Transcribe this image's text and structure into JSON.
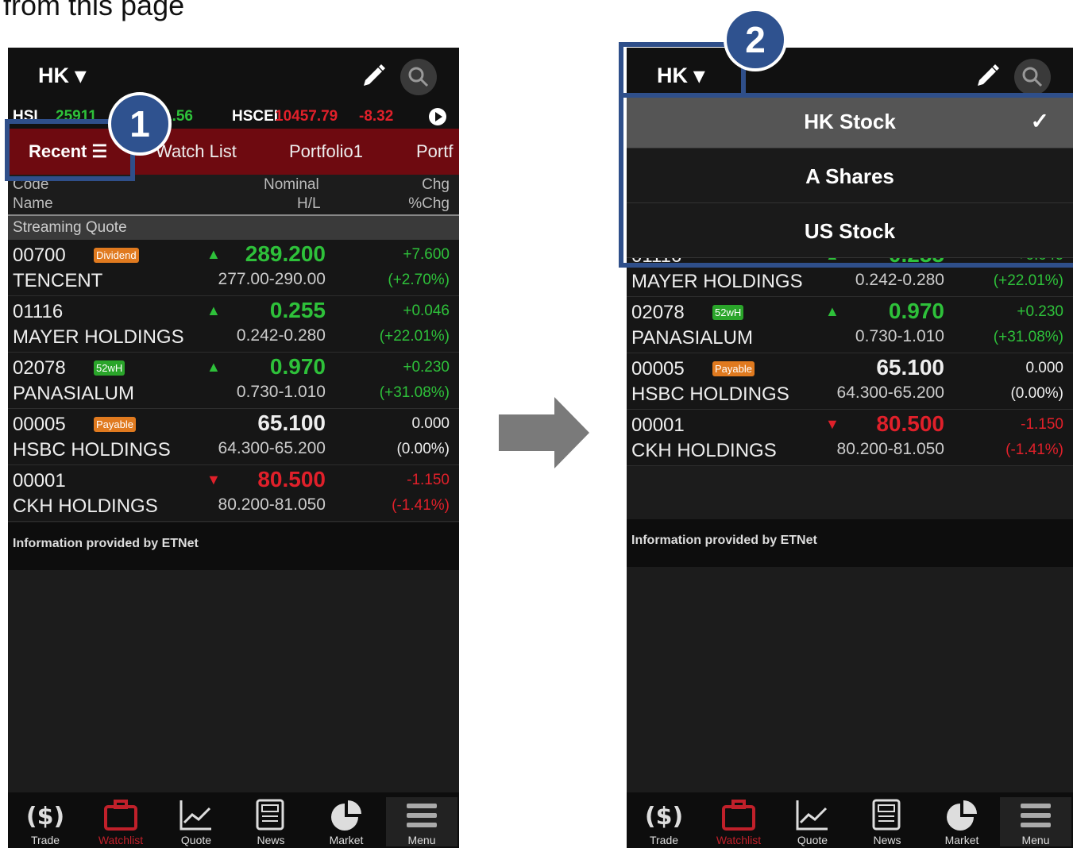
{
  "caption": "from this page",
  "topbar": {
    "market": "HK ▾"
  },
  "ticker": [
    {
      "text": "HSI",
      "color": "#ffffff"
    },
    {
      "text": "25911",
      "color": "#2ec13a"
    },
    {
      "text": "1.56",
      "color": "#2ec13a"
    },
    {
      "text": "HSCEI",
      "color": "#ffffff"
    },
    {
      "text": "10457.79",
      "color": "#e0202a"
    },
    {
      "text": "-8.32",
      "color": "#e0202a"
    }
  ],
  "tabs": [
    "Recent ☰",
    "Watch List",
    "Portfolio1",
    "Portf"
  ],
  "columns": {
    "code": "Code",
    "name": "Name",
    "nominal": "Nominal",
    "hl": "H/L",
    "chg": "Chg",
    "pct": "%Chg"
  },
  "section_title": "Streaming Quote",
  "stocks": [
    {
      "code": "00700",
      "name": "TENCENT",
      "badge": "Dividend",
      "badge_color": "orange",
      "arrow": "▲",
      "direction": "up",
      "price": "289.200",
      "hl": "277.00-290.00",
      "chg": "+7.600",
      "pct": "(+2.70%)"
    },
    {
      "code": "01116",
      "name": "MAYER HOLDINGS",
      "badge": "",
      "badge_color": "",
      "arrow": "▲",
      "direction": "up",
      "price": "0.255",
      "hl": "0.242-0.280",
      "chg": "+0.046",
      "pct": "(+22.01%)"
    },
    {
      "code": "02078",
      "name": "PANASIALUM",
      "badge": "52wH",
      "badge_color": "green",
      "arrow": "▲",
      "direction": "up",
      "price": "0.970",
      "hl": "0.730-1.010",
      "chg": "+0.230",
      "pct": "(+31.08%)"
    },
    {
      "code": "00005",
      "name": "HSBC HOLDINGS",
      "badge": "Payable",
      "badge_color": "orange",
      "arrow": "",
      "direction": "flat",
      "price": "65.100",
      "hl": "64.300-65.200",
      "chg": "0.000",
      "pct": "(0.00%)"
    },
    {
      "code": "00001",
      "name": "CKH HOLDINGS",
      "badge": "",
      "badge_color": "",
      "arrow": "▼",
      "direction": "down",
      "price": "80.500",
      "hl": "80.200-81.050",
      "chg": "-1.150",
      "pct": "(-1.41%)"
    }
  ],
  "info_text": "Information provided by ETNet",
  "nav": [
    {
      "label": "Trade",
      "icon": "dollar-icon"
    },
    {
      "label": "Watchlist",
      "icon": "briefcase-icon",
      "active": true
    },
    {
      "label": "Quote",
      "icon": "chart-icon"
    },
    {
      "label": "News",
      "icon": "newspaper-icon"
    },
    {
      "label": "Market",
      "icon": "pie-icon"
    },
    {
      "label": "Menu",
      "icon": "menu-icon"
    }
  ],
  "dropdown": {
    "items": [
      "HK Stock",
      "A Shares",
      "US Stock"
    ],
    "selected": "HK Stock",
    "check": "✓"
  },
  "callouts": [
    "1",
    "2"
  ]
}
